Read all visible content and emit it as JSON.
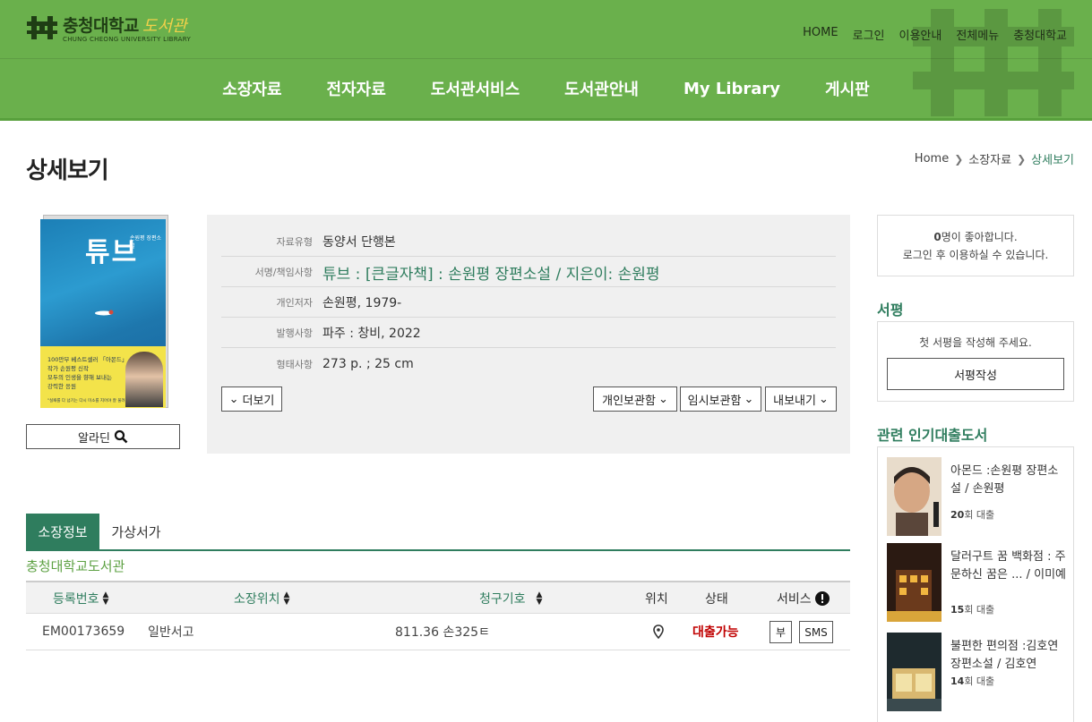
{
  "header": {
    "logo_kr": "충청대학교",
    "logo_lib": "도서관",
    "logo_en": "CHUNG CHEONG UNIVERSITY LIBRARY",
    "util_links": [
      "HOME",
      "로그인",
      "이용안내",
      "전체메뉴",
      "충청대학교"
    ],
    "nav": [
      "소장자료",
      "전자자료",
      "도서관서비스",
      "도서관안내",
      "My Library",
      "게시판"
    ],
    "accent_color": "#6ab04c"
  },
  "page": {
    "title": "상세보기",
    "breadcrumb": [
      "Home",
      "소장자료",
      "상세보기"
    ]
  },
  "book": {
    "cover_title": "튜브",
    "cover_author": "손원평 장편소설",
    "cover_band_line1": "100만부 베스트셀러 「아몬드」",
    "cover_band_line2": "작가 손원평 신작",
    "cover_band_line3": "모두의 인생을 향해 보내는",
    "cover_band_line4": "강력한 응원",
    "cover_band_line5": "\"실패를 다 넘기는 다시 미소를 지어야 잘 풀려\"",
    "aladin_label": "알라딘",
    "fields": [
      {
        "label": "자료유형",
        "value": "동양서 단행본"
      },
      {
        "label": "서명/책임사항",
        "value": "튜브 : [큰글자책] : 손원평 장편소설 / 지은이: 손원평"
      },
      {
        "label": "개인저자",
        "value": "손원평, 1979-"
      },
      {
        "label": "발행사항",
        "value": "파주 : 창비, 2022"
      },
      {
        "label": "형태사항",
        "value": "273 p. ; 25 cm"
      }
    ],
    "more_label": "더보기",
    "actions": [
      "개인보관함",
      "임시보관함",
      "내보내기"
    ]
  },
  "holdings": {
    "tabs": [
      "소장정보",
      "가상서가"
    ],
    "library_name": "충청대학교도서관",
    "columns": [
      "등록번호",
      "소장위치",
      "청구기호",
      "위치",
      "상태",
      "서비스"
    ],
    "rows": [
      {
        "reg_no": "EM00173659",
        "location": "일반서고",
        "call_no": "811.36 손325ㅌ",
        "status": "대출가능",
        "services": [
          "부",
          "SMS"
        ]
      }
    ]
  },
  "sidebar": {
    "like_count": "0",
    "like_text": "명이 좋아합니다.",
    "like_login": "로그인 후 이용하실 수 있습니다.",
    "review_heading": "서평",
    "review_msg": "첫 서평을 작성해 주세요.",
    "review_btn": "서평작성",
    "popular_heading": "관련 인기대출도서",
    "popular": [
      {
        "title": "아몬드 :손원평 장편소설 / 손원평",
        "count": "20",
        "count_suffix": "회 대출"
      },
      {
        "title": "달러구트 꿈 백화점 : 주문하신 꿈은 ... / 이미예",
        "count": "15",
        "count_suffix": "회 대출"
      },
      {
        "title": "불편한 편의점 :김호연 장편소설 / 김호연",
        "count": "14",
        "count_suffix": "회 대출"
      }
    ]
  }
}
